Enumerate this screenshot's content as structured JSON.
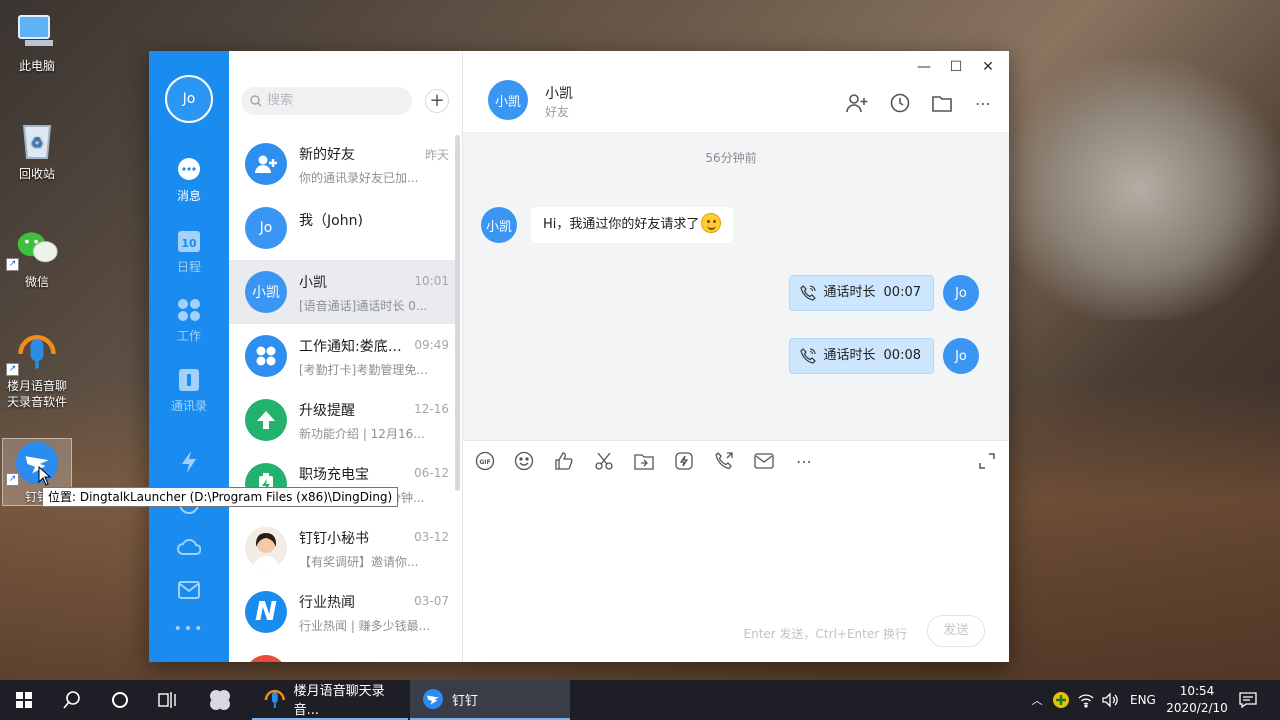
{
  "desktop": {
    "icons": [
      {
        "label": "此电脑"
      },
      {
        "label": "回收站"
      },
      {
        "label": "微信"
      },
      {
        "label": "楼月语音聊天录音软件"
      },
      {
        "label": "钉钉"
      }
    ],
    "tooltip": "位置: DingtalkLauncher (D:\\Program Files (x86)\\DingDing)"
  },
  "app": {
    "avatar": "Jo",
    "rail": [
      {
        "label": "消息",
        "icon": "chat-bubble-icon"
      },
      {
        "label": "日程",
        "icon": "calendar-icon",
        "badge": "10"
      },
      {
        "label": "工作",
        "icon": "grid-icon"
      },
      {
        "label": "通讯录",
        "icon": "contacts-icon"
      },
      {
        "label": "",
        "icon": "lightning-icon"
      },
      {
        "label": "",
        "icon": "cloud-icon"
      },
      {
        "label": "",
        "icon": "mail-icon"
      },
      {
        "label": "•••",
        "icon": "more-icon"
      }
    ],
    "search_placeholder": "搜索",
    "add_label": "+",
    "conversations": [
      {
        "name": "新的好友",
        "time": "昨天",
        "preview": "你的通讯录好友已加...",
        "avatar": "",
        "color": "#2e8ff0"
      },
      {
        "name": "我（John)",
        "time": "",
        "preview": "",
        "avatar": "Jo",
        "color": "#3a96f2"
      },
      {
        "name": "小凯",
        "time": "10:01",
        "preview": "[语音通话]通话时长 0...",
        "avatar": "小凯",
        "color": "#3a96f2"
      },
      {
        "name": "工作通知:娄底市...",
        "time": "09:49",
        "preview": "[考勤打卡]考勤管理免...",
        "avatar": "",
        "color": "#2e8ff0"
      },
      {
        "name": "升级提醒",
        "time": "12-16",
        "preview": "新功能介绍 | 12月16...",
        "avatar": "",
        "color": "#23b26d"
      },
      {
        "name": "职场充电宝",
        "time": "06-12",
        "preview": "分钟...",
        "avatar": "",
        "color": "#23b26d"
      },
      {
        "name": "钉钉小秘书",
        "time": "03-12",
        "preview": "【有奖调研】邀请你...",
        "avatar": "",
        "color": "#e8d8cc"
      },
      {
        "name": "行业热闻",
        "time": "03-07",
        "preview": "行业热闻 | 赚多少钱最...",
        "avatar": "N",
        "color": "#1a8cf0"
      }
    ],
    "window_controls": {
      "minimize": "—",
      "maximize": "☐",
      "close": "✕"
    },
    "chat": {
      "title": "小凯",
      "subtitle": "好友",
      "avatar": "小凯",
      "timestamp": "56分钟前",
      "messages": [
        {
          "from": "小凯",
          "text": "Hi，我通过你的好友请求了",
          "side": "left"
        },
        {
          "from": "Jo",
          "label": "通话时长",
          "duration": "00:07",
          "side": "right"
        },
        {
          "from": "Jo",
          "label": "通话时长",
          "duration": "00:08",
          "side": "right"
        }
      ],
      "toolbar": [
        "gif-icon",
        "emoji-icon",
        "thumbs-up-icon",
        "scissors-icon",
        "folder-icon",
        "ding-icon",
        "call-icon",
        "mail-icon",
        "more-icon",
        "expand-icon"
      ],
      "input_hint": "Enter 发送，Ctrl+Enter 换行",
      "send_label": "发送"
    }
  },
  "taskbar": {
    "apps": [
      {
        "label": "楼月语音聊天录音...",
        "icon": "microphone-icon"
      },
      {
        "label": "钉钉",
        "icon": "dingtalk-icon"
      }
    ],
    "lang": "ENG",
    "time": "10:54",
    "date": "2020/2/10"
  }
}
